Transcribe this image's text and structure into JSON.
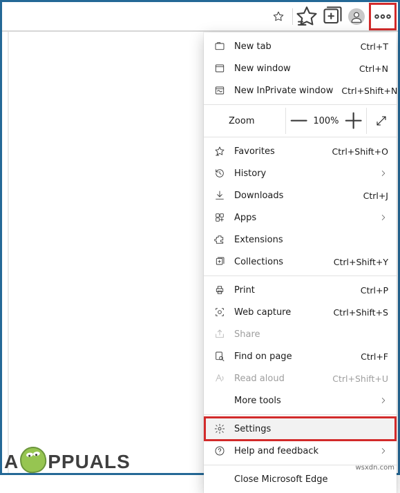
{
  "topbar": {
    "icons": {
      "favorite_this": "favorite-star-icon",
      "favorites": "favorites-icon",
      "collections": "collections-icon",
      "profile": "profile-icon",
      "more": "more-menu-icon"
    }
  },
  "zoom": {
    "label": "Zoom",
    "value": "100%"
  },
  "menu": {
    "new_tab": {
      "label": "New tab",
      "shortcut": "Ctrl+T"
    },
    "new_window": {
      "label": "New window",
      "shortcut": "Ctrl+N"
    },
    "new_inprivate": {
      "label": "New InPrivate window",
      "shortcut": "Ctrl+Shift+N"
    },
    "favorites": {
      "label": "Favorites",
      "shortcut": "Ctrl+Shift+O"
    },
    "history": {
      "label": "History",
      "shortcut": ""
    },
    "downloads": {
      "label": "Downloads",
      "shortcut": "Ctrl+J"
    },
    "apps": {
      "label": "Apps",
      "shortcut": ""
    },
    "extensions": {
      "label": "Extensions",
      "shortcut": ""
    },
    "collections": {
      "label": "Collections",
      "shortcut": "Ctrl+Shift+Y"
    },
    "print": {
      "label": "Print",
      "shortcut": "Ctrl+P"
    },
    "web_capture": {
      "label": "Web capture",
      "shortcut": "Ctrl+Shift+S"
    },
    "share": {
      "label": "Share",
      "shortcut": ""
    },
    "find": {
      "label": "Find on page",
      "shortcut": "Ctrl+F"
    },
    "read_aloud": {
      "label": "Read aloud",
      "shortcut": "Ctrl+Shift+U"
    },
    "more_tools": {
      "label": "More tools",
      "shortcut": ""
    },
    "settings": {
      "label": "Settings",
      "shortcut": ""
    },
    "help": {
      "label": "Help and feedback",
      "shortcut": ""
    },
    "close": {
      "label": "Close Microsoft Edge",
      "shortcut": ""
    }
  },
  "watermark": {
    "letter": "A",
    "rest": "PPUALS",
    "site": "wsxdn.com"
  }
}
